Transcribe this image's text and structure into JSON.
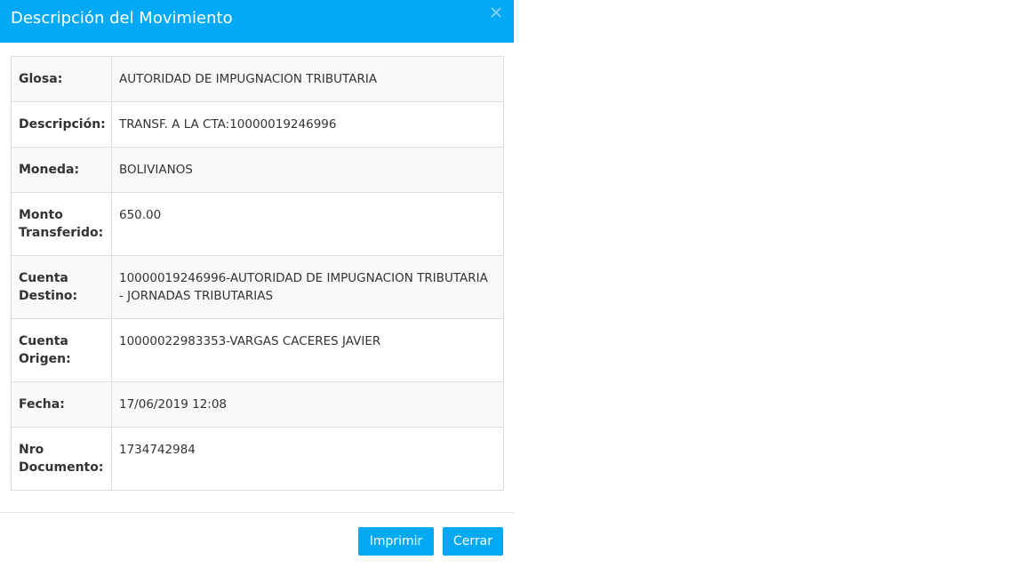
{
  "modal": {
    "title": "Descripción del Movimiento"
  },
  "rows": [
    {
      "label": "Glosa:",
      "value": "AUTORIDAD DE IMPUGNACION TRIBUTARIA"
    },
    {
      "label": "Descripción:",
      "value": "TRANSF. A LA CTA:10000019246996"
    },
    {
      "label": "Moneda:",
      "value": "BOLIVIANOS"
    },
    {
      "label": "Monto Transferido:",
      "value": "650.00"
    },
    {
      "label": "Cuenta Destino:",
      "value": "10000019246996-AUTORIDAD DE IMPUGNACION TRIBUTARIA - JORNADAS TRIBUTARIAS"
    },
    {
      "label": "Cuenta Origen:",
      "value": "10000022983353-VARGAS CACERES JAVIER"
    },
    {
      "label": "Fecha:",
      "value": "17/06/2019 12:08"
    },
    {
      "label": "Nro Documento:",
      "value": "1734742984"
    }
  ],
  "footer": {
    "print_label": "Imprimir",
    "close_label": "Cerrar"
  },
  "colors": {
    "accent": "#03a9f4"
  },
  "icons": {
    "close": "close-icon"
  }
}
